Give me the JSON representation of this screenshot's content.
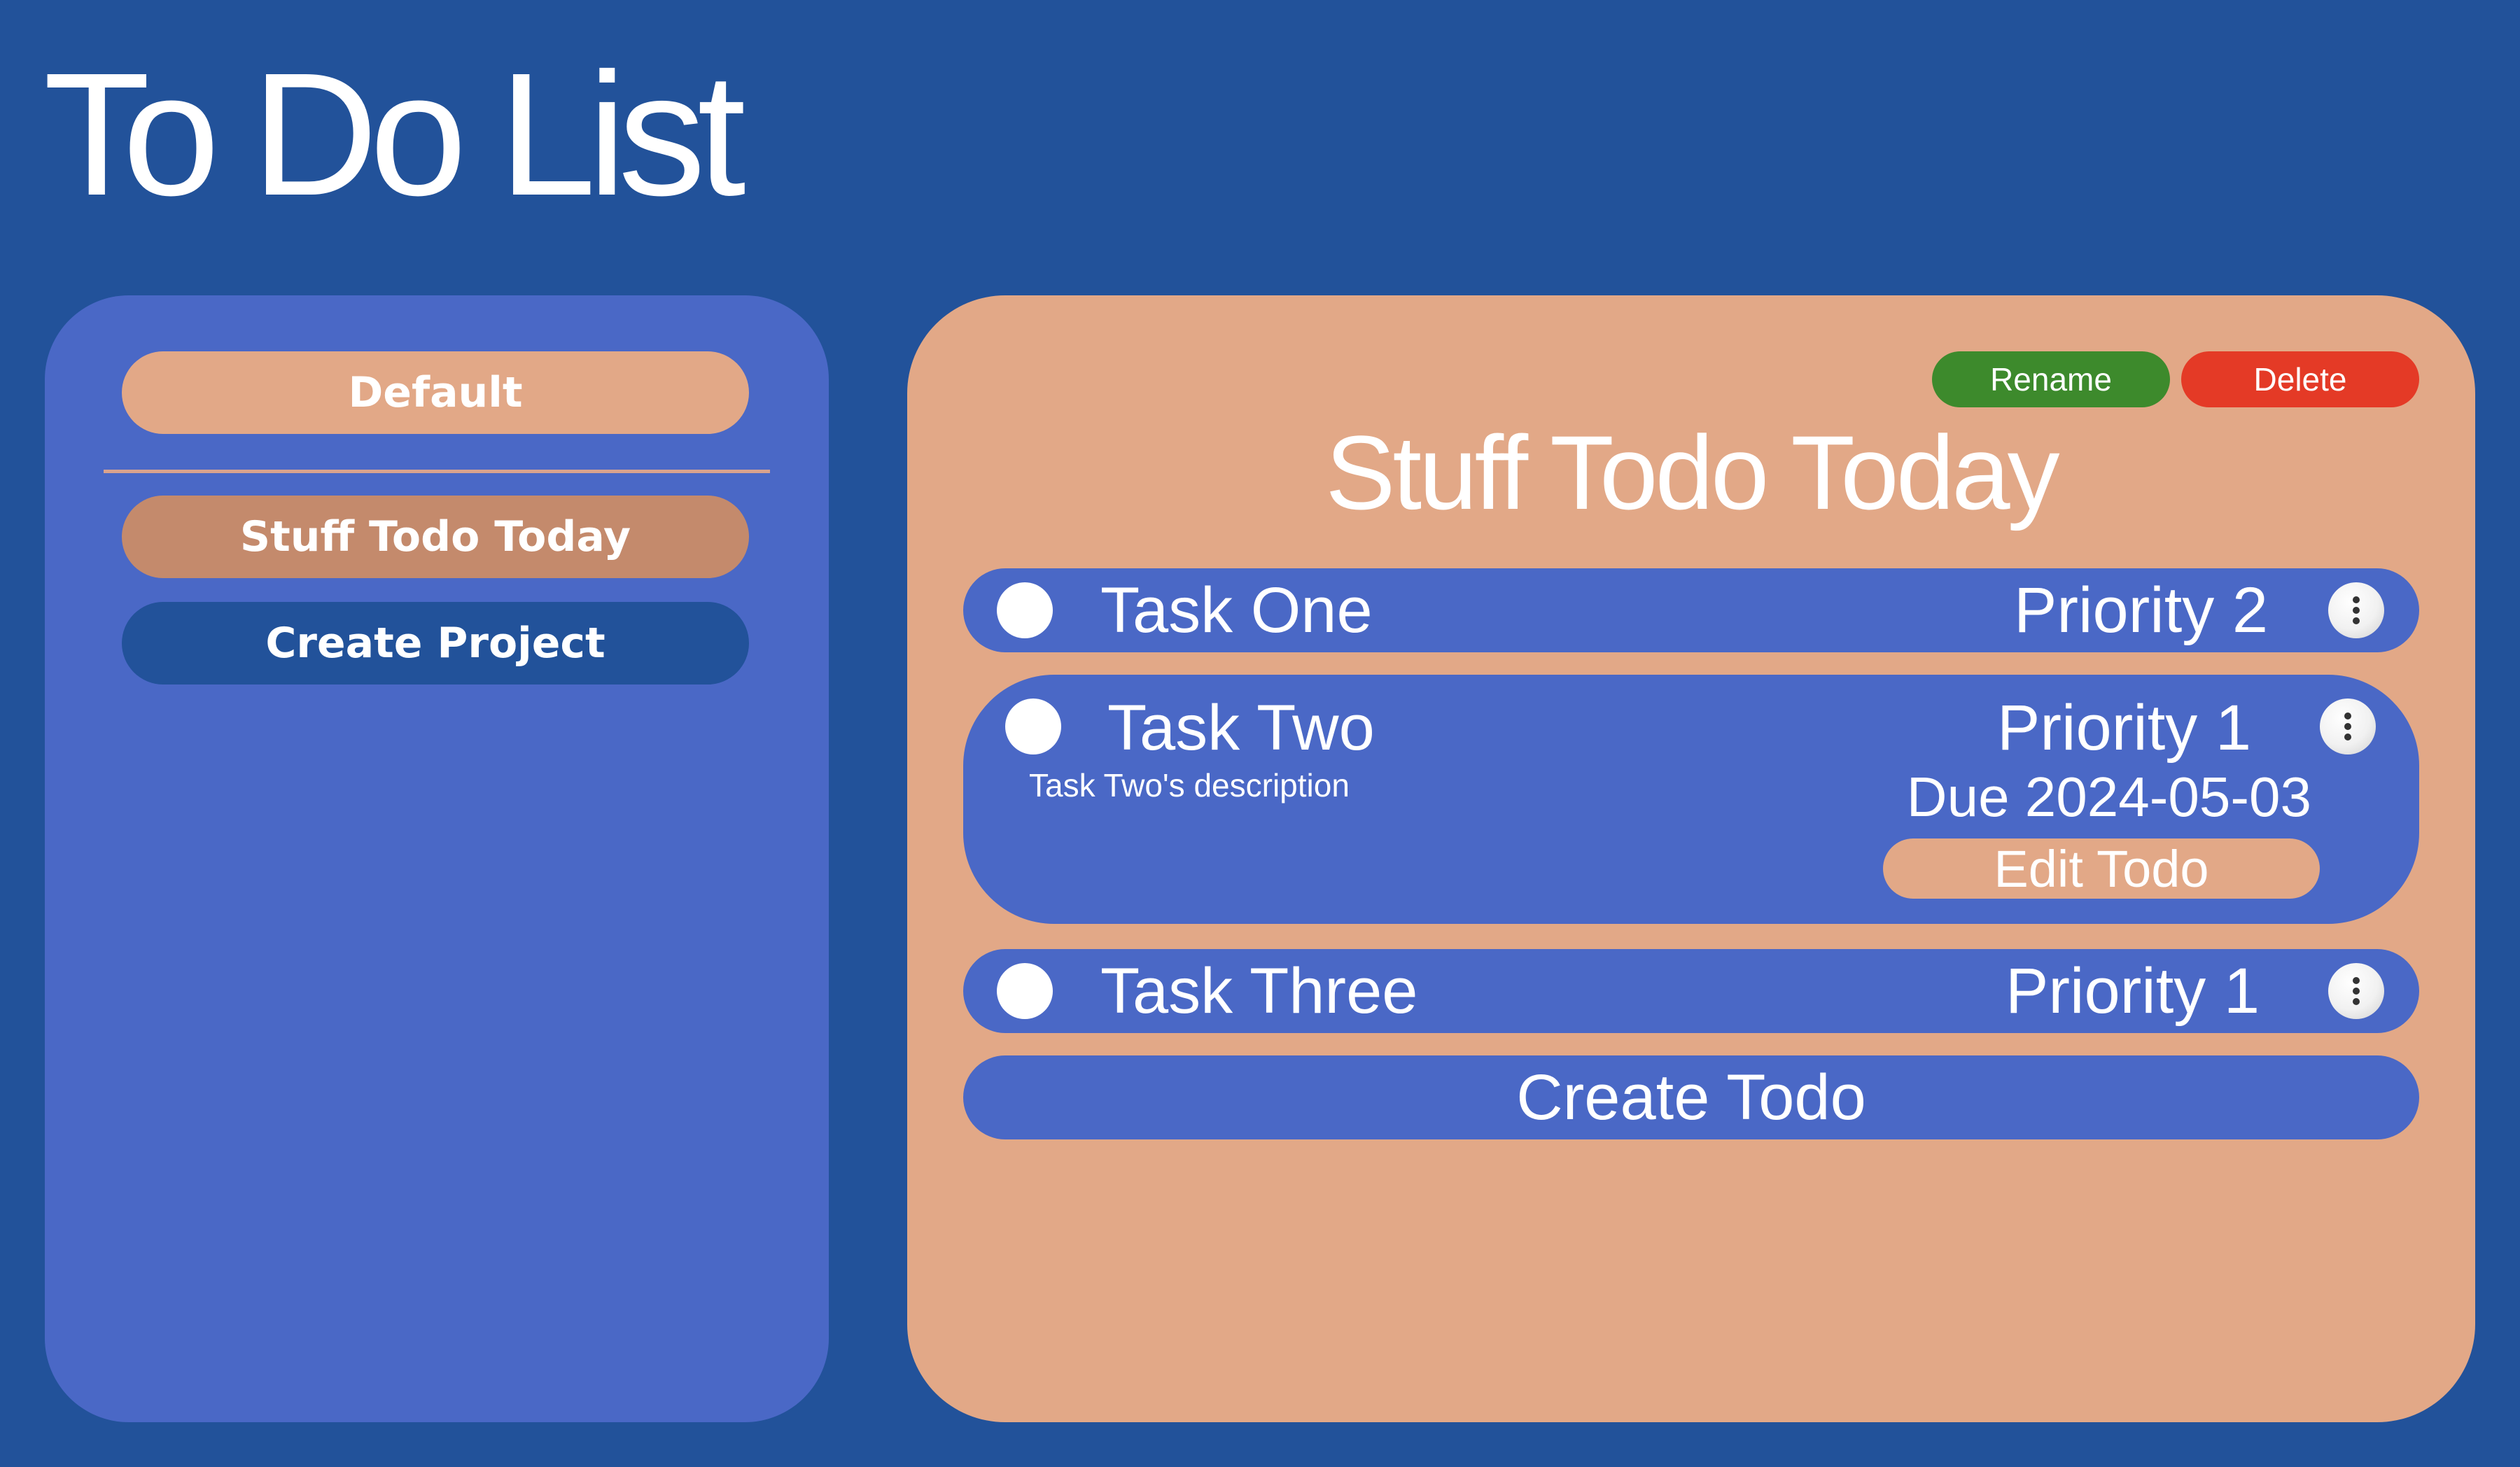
{
  "app": {
    "title": "To Do List"
  },
  "sidebar": {
    "projects": [
      {
        "label": "Default"
      },
      {
        "label": "Stuff Todo Today"
      }
    ],
    "create_project_label": "Create Project"
  },
  "project": {
    "title": "Stuff Todo Today",
    "rename_label": "Rename",
    "delete_label": "Delete",
    "todos": [
      {
        "name": "Task One",
        "priority": "Priority 2"
      },
      {
        "name": "Task Two",
        "priority": "Priority 1",
        "description": "Task Two's description",
        "due": "Due 2024-05-03",
        "edit_label": "Edit Todo"
      },
      {
        "name": "Task Three",
        "priority": "Priority 1"
      }
    ],
    "create_todo_label": "Create Todo"
  },
  "colors": {
    "background": "#22529a",
    "sidebar": "#4a68c6",
    "panel": "#e2a887",
    "active_project": "#c48a6c",
    "rename": "#3d8a2c",
    "delete": "#e43a26"
  },
  "icons": {
    "checkbox": "circle-checkbox-icon",
    "menu": "kebab-menu-icon"
  }
}
